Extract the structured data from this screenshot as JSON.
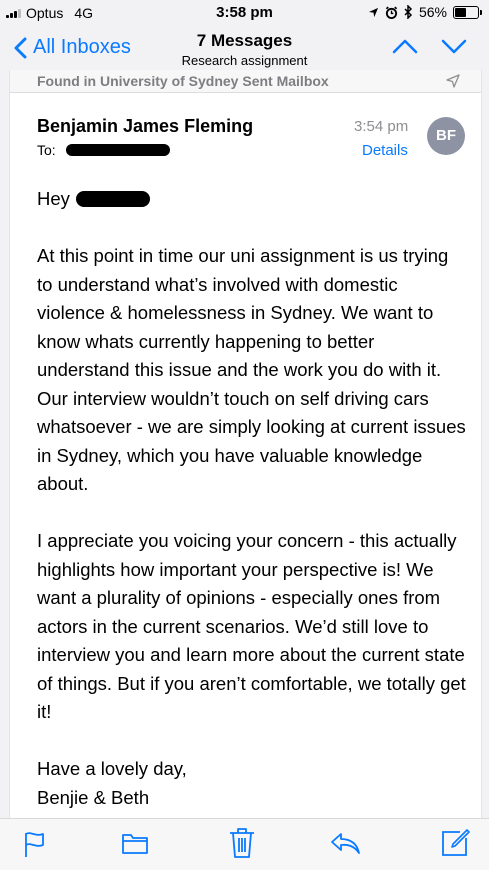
{
  "status_bar": {
    "carrier": "Optus",
    "network": "4G",
    "time": "3:58 pm",
    "battery_percent": "56%",
    "battery_level": 0.56,
    "icons": [
      "signal-icon",
      "location-icon",
      "alarm-icon",
      "bluetooth-icon",
      "battery-icon"
    ]
  },
  "nav": {
    "back_label": "All Inboxes",
    "title": "7 Messages",
    "subtitle": "Research assignment"
  },
  "mail": {
    "found_in": "Found in University of Sydney Sent Mailbox",
    "sender": "Benjamin James Fleming",
    "to_label": "To:",
    "time": "3:54 pm",
    "details_label": "Details",
    "avatar_initials": "BF",
    "greeting": "Hey",
    "paragraphs": [
      "At this point in time our uni assignment is us trying to understand what’s involved with domestic violence & homelessness in Sydney. We want to know whats currently happening to better understand this issue and the work you do with it. Our interview wouldn’t touch on self driving cars whatsoever - we are simply looking at current issues in Sydney, which you have valuable knowledge about.",
      "I appreciate you voicing your concern - this actually highlights how important your perspective is! We want a plurality of opinions - especially ones from actors in the current scenarios. We’d still love to interview you and learn more about the current state of things. But if you aren’t comfortable, we totally get it!"
    ],
    "signoff": "Have a lovely day,",
    "signature": "Benjie & Beth"
  },
  "toolbar": {
    "icons": [
      "flag-icon",
      "folder-icon",
      "trash-icon",
      "reply-icon",
      "compose-icon"
    ]
  },
  "colors": {
    "accent": "#0a7aff",
    "avatar_bg": "#8e93a3",
    "secondary_text": "#8e8e93"
  }
}
